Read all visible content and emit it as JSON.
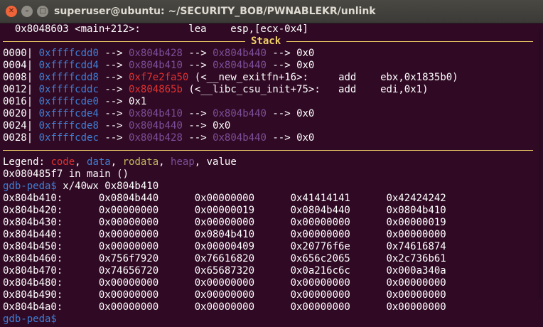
{
  "window": {
    "title": "superuser@ubuntu: ~/SECURITY_BOB/PWNABLEKR/unlink",
    "close_glyph": "✕",
    "min_glyph": "–",
    "max_glyph": "□"
  },
  "code_line": "  0x8048603 <main+212>:        lea    esp,[ecx-0x4]",
  "stack_label": "Stack",
  "stack": [
    {
      "off": "0000|",
      "addr": "0xffffcdd0",
      "v1": "0x804b428",
      "v2": "0x804b440",
      "v3": "0x0"
    },
    {
      "off": "0004|",
      "addr": "0xffffcdd4",
      "v1": "0x804b410",
      "v2": "0x804b440",
      "v3": "0x0"
    },
    {
      "off": "0008|",
      "addr": "0xffffcdd8",
      "v1": "0xf7e2fa50",
      "sym": "(<__new_exitfn+16>:     add    ebx,0x1835b0)"
    },
    {
      "off": "0012|",
      "addr": "0xffffcddc",
      "v1": "0x804865b",
      "sym": "(<__libc_csu_init+75>:   add    edi,0x1)"
    },
    {
      "off": "0016|",
      "addr": "0xffffcde0",
      "plain": "0x1"
    },
    {
      "off": "0020|",
      "addr": "0xffffcde4",
      "v1": "0x804b410",
      "v2": "0x804b440",
      "v3": "0x0"
    },
    {
      "off": "0024|",
      "addr": "0xffffcde8",
      "v1": "0x804b440",
      "v3": "0x0"
    },
    {
      "off": "0028|",
      "addr": "0xffffcdec",
      "v1": "0x804b428",
      "v2": "0x804b440",
      "v3": "0x0"
    }
  ],
  "arrow": " --> ",
  "legend": {
    "prefix": "Legend: ",
    "code": "code",
    "data": "data",
    "rodata": "rodata",
    "heap": "heap",
    "value": "value",
    "comma": ", "
  },
  "location_line": "0x080485f7 in main ()",
  "prompt": "gdb-peda$",
  "command": " x/40wx 0x804b410",
  "memory_dump": [
    "0x804b410:      0x0804b440      0x00000000      0x41414141      0x42424242",
    "0x804b420:      0x00000000      0x00000019      0x0804b440      0x0804b410",
    "0x804b430:      0x00000000      0x00000000      0x00000000      0x00000019",
    "0x804b440:      0x00000000      0x0804b410      0x00000000      0x00000000",
    "0x804b450:      0x00000000      0x00000409      0x20776f6e      0x74616874",
    "0x804b460:      0x756f7920      0x76616820      0x656c2065      0x2c736b61",
    "0x804b470:      0x74656720      0x65687320      0x0a216c6c      0x000a340a",
    "0x804b480:      0x00000000      0x00000000      0x00000000      0x00000000",
    "0x804b490:      0x00000000      0x00000000      0x00000000      0x00000000",
    "0x804b4a0:      0x00000000      0x00000000      0x00000000      0x00000000"
  ],
  "final_prompt": "gdb-peda$",
  "colors": {
    "background": "#300a24",
    "code": "#e03131",
    "data": "#3f7ed4",
    "rodata": "#c5b85f",
    "heap": "#7d4e9a",
    "separator": "#f2d067"
  }
}
